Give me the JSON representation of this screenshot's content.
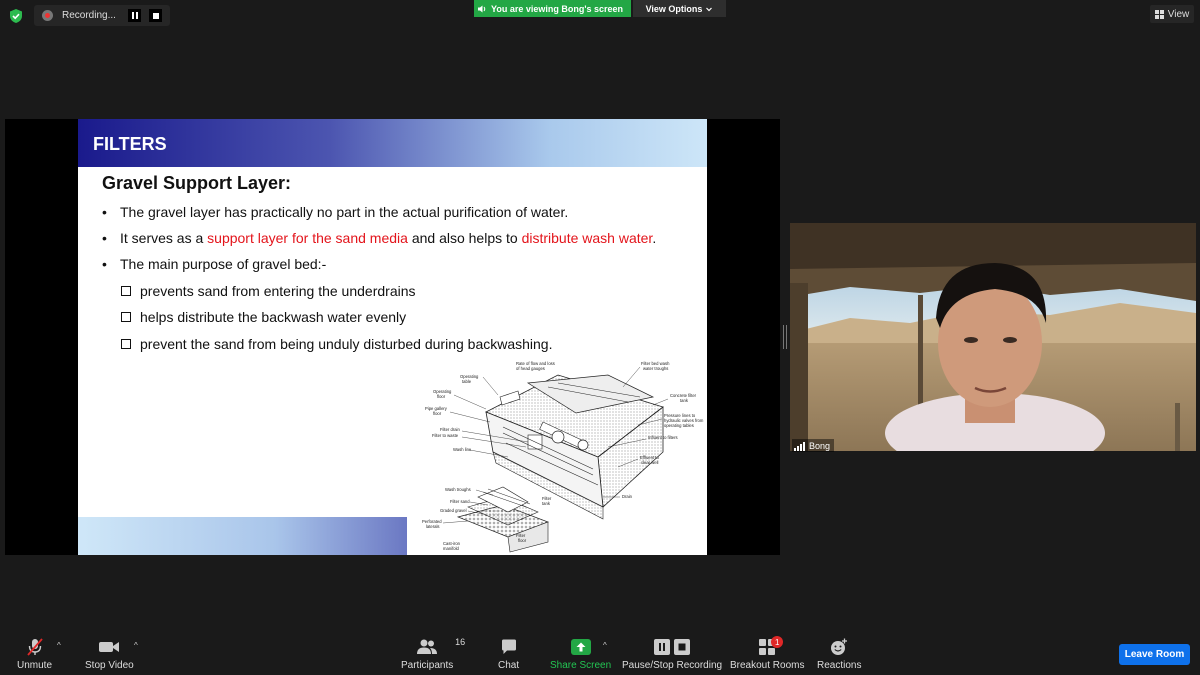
{
  "top_bar": {
    "recording_label": "Recording...",
    "banner_text": "You are viewing Bong's screen",
    "view_options_label": "View Options",
    "view_label": "View"
  },
  "slide": {
    "title": "FILTERS",
    "heading": "Gravel Support Layer:",
    "bullet_1": "The gravel layer has practically no part in the actual purification of water.",
    "bullet_2": {
      "part_1": "It serves as a ",
      "part_2_red": "support layer for the sand media",
      "part_3": " and also helps to ",
      "part_4_red": "distribute wash water",
      "part_5": "."
    },
    "bullet_3": "The main purpose of gravel bed:-",
    "sub_1": "prevents sand from entering the underdrains",
    "sub_2": "helps distribute the backwash water evenly",
    "sub_3": "prevent the sand from being unduly disturbed during backwashing.",
    "diagram_labels": {
      "rate_flow": "Rate of flow and loss",
      "head_gauges": "of head gauges",
      "operating_table": "Operating",
      "operating_table_2": "table",
      "filter_bed_wash": "Filter bed wash",
      "water_troughs": "water troughs",
      "operating_floor": "Operating",
      "operating_floor_2": "floor",
      "concrete_filter": "Concrete filter",
      "tank": "tank",
      "pipe_gallery": "Pipe gallery",
      "floor": "floor",
      "pressure_lines": "Pressure lines to",
      "hydraulic_valves": "hydraulic valves from",
      "operating_tables": "operating tables",
      "filter_drain": "Filter drain",
      "filter_to_waste": "Filter to waste",
      "influent": "Influent to filters",
      "wash_line": "Wash line",
      "effluent": "Effluent to",
      "clear_well": "clear well",
      "wash_troughs": "Wash troughs",
      "filter_sand": "Filter sand",
      "graded_gravel": "Graded gravel",
      "perforated": "Perforated",
      "laterals": "laterals",
      "cast_iron": "Cast-iron",
      "manifold": "manifold",
      "filter_tank": "Filter",
      "filter_tank_2": "tank",
      "filter_floor": "Filter",
      "filter_floor_2": "floor",
      "drain": "Drain"
    }
  },
  "video": {
    "participant_name": "Bong"
  },
  "toolbar": {
    "unmute": "Unmute",
    "stop_video": "Stop Video",
    "participants": "Participants",
    "participants_count": "16",
    "chat": "Chat",
    "share_screen": "Share Screen",
    "pause_stop_recording": "Pause/Stop Recording",
    "breakout_rooms": "Breakout Rooms",
    "breakout_badge": "1",
    "reactions": "Reactions",
    "leave_room": "Leave Room"
  },
  "colors": {
    "share_green": "#23a745",
    "leave_blue": "#0e71eb",
    "slide_red": "#e3141b",
    "badge_red": "#e02828"
  }
}
